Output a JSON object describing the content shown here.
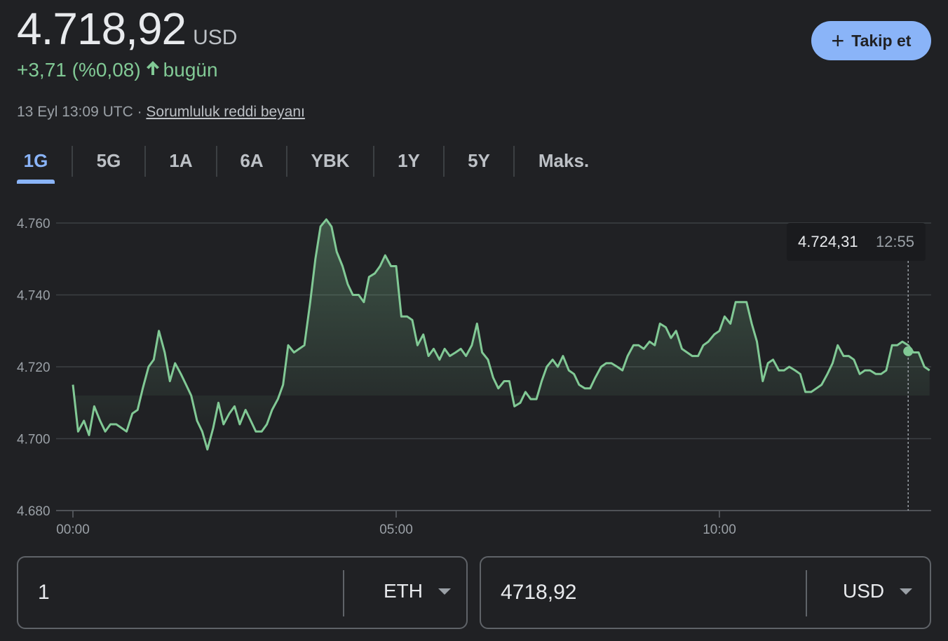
{
  "header": {
    "price": "4.718,92",
    "currency": "USD",
    "change": "+3,71 (%0,08)",
    "change_period": "bugün",
    "timestamp": "13 Eyl 13:09 UTC ·",
    "disclaimer": "Sorumluluk reddi beyanı",
    "follow_label": "Takip et"
  },
  "tabs": [
    {
      "label": "1G",
      "active": true
    },
    {
      "label": "5G"
    },
    {
      "label": "1A"
    },
    {
      "label": "6A"
    },
    {
      "label": "YBK"
    },
    {
      "label": "1Y"
    },
    {
      "label": "5Y"
    },
    {
      "label": "Maks."
    }
  ],
  "tooltip": {
    "value": "4.724,31",
    "time": "12:55"
  },
  "colors": {
    "line": "#81c995",
    "accent": "#8ab4f8",
    "background": "#202124",
    "grid": "#3c4043"
  },
  "chart_data": {
    "type": "area",
    "ylim": [
      4680,
      4760
    ],
    "yticks": [
      "4.760",
      "4.740",
      "4.720",
      "4.700",
      "4.680"
    ],
    "xticks": [
      "00:00",
      "05:00",
      "10:00"
    ],
    "grid": true,
    "x_hours": [
      0.0,
      0.08,
      0.17,
      0.25,
      0.33,
      0.42,
      0.5,
      0.58,
      0.67,
      0.75,
      0.83,
      0.92,
      1.0,
      1.08,
      1.17,
      1.25,
      1.33,
      1.42,
      1.5,
      1.58,
      1.67,
      1.75,
      1.83,
      1.92,
      2.0,
      2.08,
      2.17,
      2.25,
      2.33,
      2.42,
      2.5,
      2.58,
      2.67,
      2.75,
      2.83,
      2.92,
      3.0,
      3.08,
      3.17,
      3.25,
      3.33,
      3.42,
      3.5,
      3.58,
      3.67,
      3.75,
      3.83,
      3.92,
      4.0,
      4.08,
      4.17,
      4.25,
      4.33,
      4.42,
      4.5,
      4.58,
      4.67,
      4.75,
      4.83,
      4.92,
      5.0,
      5.08,
      5.17,
      5.25,
      5.33,
      5.42,
      5.5,
      5.58,
      5.67,
      5.75,
      5.83,
      5.92,
      6.0,
      6.08,
      6.17,
      6.25,
      6.33,
      6.42,
      6.5,
      6.58,
      6.67,
      6.75,
      6.83,
      6.92,
      7.0,
      7.08,
      7.17,
      7.25,
      7.33,
      7.42,
      7.5,
      7.58,
      7.67,
      7.75,
      7.83,
      7.92,
      8.0,
      8.08,
      8.17,
      8.25,
      8.33,
      8.42,
      8.5,
      8.58,
      8.67,
      8.75,
      8.83,
      8.92,
      9.0,
      9.08,
      9.17,
      9.25,
      9.33,
      9.42,
      9.5,
      9.58,
      9.67,
      9.75,
      9.83,
      9.92,
      10.0,
      10.08,
      10.17,
      10.25,
      10.33,
      10.42,
      10.5,
      10.58,
      10.67,
      10.75,
      10.83,
      10.92,
      11.0,
      11.08,
      11.17,
      11.25,
      11.33,
      11.42,
      11.5,
      11.58,
      11.67,
      11.75,
      11.83,
      11.92,
      12.0,
      12.08,
      12.17,
      12.25,
      12.33,
      12.42,
      12.5,
      12.58,
      12.67,
      12.75,
      12.83,
      12.92,
      13.0,
      13.08,
      13.17,
      13.25
    ],
    "values": [
      4715,
      4702,
      4705,
      4701,
      4709,
      4705,
      4702,
      4704,
      4704,
      4703,
      4702,
      4707,
      4708,
      4714,
      4720,
      4722,
      4730,
      4724,
      4716,
      4721,
      4718,
      4715,
      4712,
      4705,
      4702,
      4697,
      4703,
      4710,
      4704,
      4707,
      4709,
      4704,
      4708,
      4705,
      4702,
      4702,
      4704,
      4708,
      4711,
      4715,
      4726,
      4724,
      4725,
      4726,
      4738,
      4750,
      4759,
      4761,
      4759,
      4752,
      4748,
      4743,
      4740,
      4740,
      4738,
      4745,
      4746,
      4748,
      4751,
      4748,
      4748,
      4734,
      4734,
      4733,
      4726,
      4729,
      4723,
      4725,
      4722,
      4725,
      4723,
      4724,
      4725,
      4723,
      4726,
      4732,
      4724,
      4722,
      4717,
      4714,
      4716,
      4716,
      4709,
      4710,
      4713,
      4711,
      4711,
      4716,
      4720,
      4722,
      4720,
      4723,
      4719,
      4718,
      4715,
      4714,
      4714,
      4717,
      4720,
      4721,
      4721,
      4720,
      4719,
      4723,
      4726,
      4726,
      4725,
      4727,
      4726,
      4732,
      4731,
      4728,
      4730,
      4725,
      4724,
      4723,
      4723,
      4726,
      4727,
      4729,
      4730,
      4734,
      4732,
      4738,
      4738,
      4738,
      4732,
      4727,
      4716,
      4721,
      4722,
      4719,
      4719,
      4720,
      4719,
      4718,
      4713,
      4713,
      4714,
      4715,
      4718,
      4721,
      4726,
      4723,
      4723,
      4722,
      4718,
      4719,
      4719,
      4718,
      4718,
      4719,
      4726,
      4726,
      4727,
      4726,
      4724,
      4724,
      4720,
      4719
    ]
  },
  "converter": {
    "from_value": "1",
    "from_currency": "ETH",
    "to_value": "4718,92",
    "to_currency": "USD"
  }
}
